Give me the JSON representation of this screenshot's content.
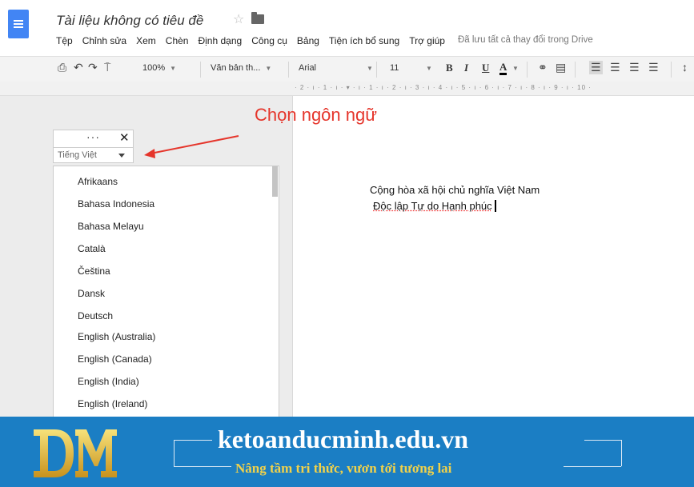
{
  "header": {
    "title": "Tài liệu không có tiêu đề",
    "menu": [
      "Tệp",
      "Chỉnh sửa",
      "Xem",
      "Chèn",
      "Định dạng",
      "Công cụ",
      "Bảng",
      "Tiện ích bổ sung",
      "Trợ giúp"
    ],
    "saved_status": "Đã lưu tất cả thay đổi trong Drive"
  },
  "toolbar": {
    "zoom": "100%",
    "style": "Văn bản th...",
    "font": "Arial",
    "size": "11",
    "bold": "B",
    "italic": "I",
    "underline": "U",
    "text_color": "A"
  },
  "ruler": {
    "text": "· 2 · ı · 1 · ı · ▾ · ı · 1 · ı · 2 · ı · 3 · ı · 4 · ı · 5 · ı · 6 · ı · 7 · ı · 8 · ı · 9 · ı · 10 ·"
  },
  "annotation": {
    "text": "Chọn ngôn ngữ",
    "color": "#e5352b"
  },
  "panel": {
    "dots": "···",
    "close": "✕",
    "selected_language": "Tiếng Việt",
    "languages": [
      "Afrikaans",
      "Bahasa Indonesia",
      "Bahasa Melayu",
      "Català",
      "Čeština",
      "Dansk",
      "Deutsch",
      "English (Australia)",
      "English (Canada)",
      "English (India)",
      "English (Ireland)"
    ]
  },
  "document": {
    "line1": "Cộng hòa xã hội chủ nghĩa Việt Nam",
    "line2": "Độc lập Tự do Hạnh phúc"
  },
  "footer": {
    "site": "ketoanducminh.edu.vn",
    "tagline": "Nâng tầm tri thức, vươn tới tương lai",
    "background": "#1b7ec4",
    "tagline_color": "#f2d24a"
  },
  "colors": {
    "docs_blue": "#4285f4",
    "toolbar_bg": "#f3f3f3"
  }
}
